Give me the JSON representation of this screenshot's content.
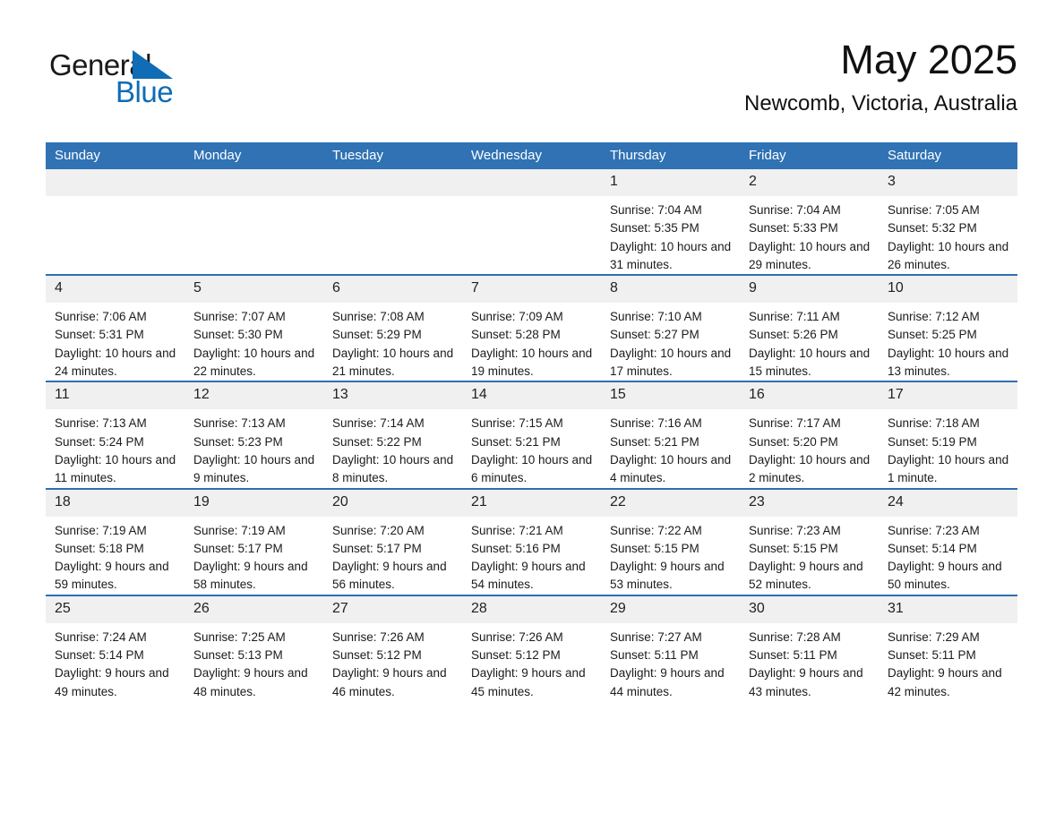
{
  "logo": {
    "word_general": "General",
    "word_blue": "Blue",
    "triangle_color": "#0f6cb5"
  },
  "header": {
    "month_title": "May 2025",
    "location": "Newcomb, Victoria, Australia"
  },
  "theme": {
    "header_blue": "#3072b4",
    "row_divider_blue": "#2f6fb0",
    "daynum_band": "#f0f0f0",
    "page_background": "#ffffff"
  },
  "calendar": {
    "weekday_headers": [
      "Sunday",
      "Monday",
      "Tuesday",
      "Wednesday",
      "Thursday",
      "Friday",
      "Saturday"
    ],
    "weeks": [
      [
        {
          "day": "",
          "sunrise": "",
          "sunset": "",
          "daylight": "",
          "empty": true
        },
        {
          "day": "",
          "sunrise": "",
          "sunset": "",
          "daylight": "",
          "empty": true
        },
        {
          "day": "",
          "sunrise": "",
          "sunset": "",
          "daylight": "",
          "empty": true
        },
        {
          "day": "",
          "sunrise": "",
          "sunset": "",
          "daylight": "",
          "empty": true
        },
        {
          "day": "1",
          "sunrise": "Sunrise: 7:04 AM",
          "sunset": "Sunset: 5:35 PM",
          "daylight": "Daylight: 10 hours and 31 minutes."
        },
        {
          "day": "2",
          "sunrise": "Sunrise: 7:04 AM",
          "sunset": "Sunset: 5:33 PM",
          "daylight": "Daylight: 10 hours and 29 minutes."
        },
        {
          "day": "3",
          "sunrise": "Sunrise: 7:05 AM",
          "sunset": "Sunset: 5:32 PM",
          "daylight": "Daylight: 10 hours and 26 minutes."
        }
      ],
      [
        {
          "day": "4",
          "sunrise": "Sunrise: 7:06 AM",
          "sunset": "Sunset: 5:31 PM",
          "daylight": "Daylight: 10 hours and 24 minutes."
        },
        {
          "day": "5",
          "sunrise": "Sunrise: 7:07 AM",
          "sunset": "Sunset: 5:30 PM",
          "daylight": "Daylight: 10 hours and 22 minutes."
        },
        {
          "day": "6",
          "sunrise": "Sunrise: 7:08 AM",
          "sunset": "Sunset: 5:29 PM",
          "daylight": "Daylight: 10 hours and 21 minutes."
        },
        {
          "day": "7",
          "sunrise": "Sunrise: 7:09 AM",
          "sunset": "Sunset: 5:28 PM",
          "daylight": "Daylight: 10 hours and 19 minutes."
        },
        {
          "day": "8",
          "sunrise": "Sunrise: 7:10 AM",
          "sunset": "Sunset: 5:27 PM",
          "daylight": "Daylight: 10 hours and 17 minutes."
        },
        {
          "day": "9",
          "sunrise": "Sunrise: 7:11 AM",
          "sunset": "Sunset: 5:26 PM",
          "daylight": "Daylight: 10 hours and 15 minutes."
        },
        {
          "day": "10",
          "sunrise": "Sunrise: 7:12 AM",
          "sunset": "Sunset: 5:25 PM",
          "daylight": "Daylight: 10 hours and 13 minutes."
        }
      ],
      [
        {
          "day": "11",
          "sunrise": "Sunrise: 7:13 AM",
          "sunset": "Sunset: 5:24 PM",
          "daylight": "Daylight: 10 hours and 11 minutes."
        },
        {
          "day": "12",
          "sunrise": "Sunrise: 7:13 AM",
          "sunset": "Sunset: 5:23 PM",
          "daylight": "Daylight: 10 hours and 9 minutes."
        },
        {
          "day": "13",
          "sunrise": "Sunrise: 7:14 AM",
          "sunset": "Sunset: 5:22 PM",
          "daylight": "Daylight: 10 hours and 8 minutes."
        },
        {
          "day": "14",
          "sunrise": "Sunrise: 7:15 AM",
          "sunset": "Sunset: 5:21 PM",
          "daylight": "Daylight: 10 hours and 6 minutes."
        },
        {
          "day": "15",
          "sunrise": "Sunrise: 7:16 AM",
          "sunset": "Sunset: 5:21 PM",
          "daylight": "Daylight: 10 hours and 4 minutes."
        },
        {
          "day": "16",
          "sunrise": "Sunrise: 7:17 AM",
          "sunset": "Sunset: 5:20 PM",
          "daylight": "Daylight: 10 hours and 2 minutes."
        },
        {
          "day": "17",
          "sunrise": "Sunrise: 7:18 AM",
          "sunset": "Sunset: 5:19 PM",
          "daylight": "Daylight: 10 hours and 1 minute."
        }
      ],
      [
        {
          "day": "18",
          "sunrise": "Sunrise: 7:19 AM",
          "sunset": "Sunset: 5:18 PM",
          "daylight": "Daylight: 9 hours and 59 minutes."
        },
        {
          "day": "19",
          "sunrise": "Sunrise: 7:19 AM",
          "sunset": "Sunset: 5:17 PM",
          "daylight": "Daylight: 9 hours and 58 minutes."
        },
        {
          "day": "20",
          "sunrise": "Sunrise: 7:20 AM",
          "sunset": "Sunset: 5:17 PM",
          "daylight": "Daylight: 9 hours and 56 minutes."
        },
        {
          "day": "21",
          "sunrise": "Sunrise: 7:21 AM",
          "sunset": "Sunset: 5:16 PM",
          "daylight": "Daylight: 9 hours and 54 minutes."
        },
        {
          "day": "22",
          "sunrise": "Sunrise: 7:22 AM",
          "sunset": "Sunset: 5:15 PM",
          "daylight": "Daylight: 9 hours and 53 minutes."
        },
        {
          "day": "23",
          "sunrise": "Sunrise: 7:23 AM",
          "sunset": "Sunset: 5:15 PM",
          "daylight": "Daylight: 9 hours and 52 minutes."
        },
        {
          "day": "24",
          "sunrise": "Sunrise: 7:23 AM",
          "sunset": "Sunset: 5:14 PM",
          "daylight": "Daylight: 9 hours and 50 minutes."
        }
      ],
      [
        {
          "day": "25",
          "sunrise": "Sunrise: 7:24 AM",
          "sunset": "Sunset: 5:14 PM",
          "daylight": "Daylight: 9 hours and 49 minutes."
        },
        {
          "day": "26",
          "sunrise": "Sunrise: 7:25 AM",
          "sunset": "Sunset: 5:13 PM",
          "daylight": "Daylight: 9 hours and 48 minutes."
        },
        {
          "day": "27",
          "sunrise": "Sunrise: 7:26 AM",
          "sunset": "Sunset: 5:12 PM",
          "daylight": "Daylight: 9 hours and 46 minutes."
        },
        {
          "day": "28",
          "sunrise": "Sunrise: 7:26 AM",
          "sunset": "Sunset: 5:12 PM",
          "daylight": "Daylight: 9 hours and 45 minutes."
        },
        {
          "day": "29",
          "sunrise": "Sunrise: 7:27 AM",
          "sunset": "Sunset: 5:11 PM",
          "daylight": "Daylight: 9 hours and 44 minutes."
        },
        {
          "day": "30",
          "sunrise": "Sunrise: 7:28 AM",
          "sunset": "Sunset: 5:11 PM",
          "daylight": "Daylight: 9 hours and 43 minutes."
        },
        {
          "day": "31",
          "sunrise": "Sunrise: 7:29 AM",
          "sunset": "Sunset: 5:11 PM",
          "daylight": "Daylight: 9 hours and 42 minutes."
        }
      ]
    ]
  }
}
